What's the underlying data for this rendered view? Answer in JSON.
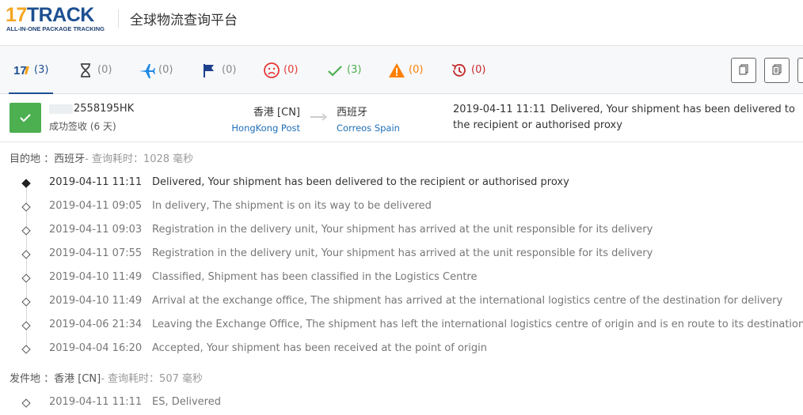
{
  "header": {
    "logo_top": "17TRACK",
    "logo_17": "17",
    "logo_track": "TRACK",
    "logo_sub": "ALL-IN-ONE PACKAGE TRACKING",
    "title": "全球物流查询平台"
  },
  "tabs": [
    {
      "name": "all",
      "icon": "17-logo-icon",
      "count": "(3)",
      "active": true
    },
    {
      "name": "pending",
      "icon": "hourglass-icon",
      "count": "(0)"
    },
    {
      "name": "in-transit",
      "icon": "airplane-icon",
      "count": "(0)"
    },
    {
      "name": "pick-up",
      "icon": "flag-icon",
      "count": "(0)"
    },
    {
      "name": "undelivered",
      "icon": "sad-face-icon",
      "count": "(0)"
    },
    {
      "name": "delivered",
      "icon": "checkmark-icon",
      "count": "(3)"
    },
    {
      "name": "alert",
      "icon": "warning-icon",
      "count": "(0)"
    },
    {
      "name": "expired",
      "icon": "history-icon",
      "count": "(0)"
    }
  ],
  "summary": {
    "tracking_number": "2558195HK",
    "status": "成功签收 (6 天)",
    "origin_country": "香港 [CN]",
    "origin_carrier": "HongKong Post",
    "dest_country": "西班牙",
    "dest_carrier": "Correos Spain",
    "latest_time": "2019-04-11 11:11",
    "latest_desc": "Delivered, Your shipment has been delivered to the recipient or authorised proxy"
  },
  "destination_section": {
    "label": "目的地 ：西班牙",
    "meta": "- 查询耗时：1028 毫秒",
    "events": [
      {
        "time": "2019-04-11 11:11",
        "desc": "Delivered, Your shipment has been delivered to the recipient or authorised proxy"
      },
      {
        "time": "2019-04-11 09:05",
        "desc": "In delivery, The shipment is on its way to be delivered"
      },
      {
        "time": "2019-04-11 09:03",
        "desc": "Registration in the delivery unit, Your shipment has arrived at the unit responsible for its delivery"
      },
      {
        "time": "2019-04-11 07:55",
        "desc": "Registration in the delivery unit, Your shipment has arrived at the unit responsible for its delivery"
      },
      {
        "time": "2019-04-10 11:49",
        "desc": "Classified, Shipment has been classified in the Logistics Centre"
      },
      {
        "time": "2019-04-10 11:49",
        "desc": "Arrival at the exchange office, The shipment has arrived at the international logistics centre of the destination for delivery"
      },
      {
        "time": "2019-04-06 21:34",
        "desc": "Leaving the Exchange Office, The shipment has left the international logistics centre of origin and is en route to its destination"
      },
      {
        "time": "2019-04-04 16:20",
        "desc": "Accepted, Your shipment has been received at the point of origin"
      }
    ]
  },
  "origin_section": {
    "label": "发件地 ：香港 [CN]",
    "meta": "- 查询耗时：507 毫秒",
    "events": [
      {
        "time": "2019-04-11 11:11",
        "desc": "ES, Delivered"
      }
    ]
  },
  "colors": {
    "brand_blue": "#1d4f91",
    "brand_orange": "#f5a623",
    "success_green": "#4caf50",
    "link_blue": "#1e6fb8"
  }
}
